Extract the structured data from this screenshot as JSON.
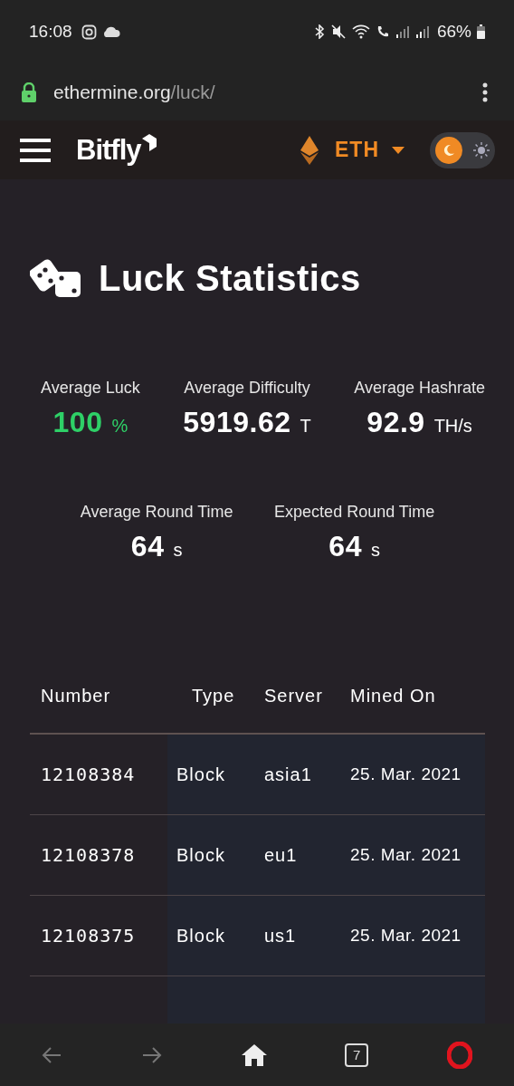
{
  "status_bar": {
    "time": "16:08",
    "battery": "66%"
  },
  "address_bar": {
    "domain": "ethermine.org",
    "path": "/luck/"
  },
  "navbar": {
    "logo": "Bitfly",
    "currency": "ETH",
    "light_mode": false
  },
  "page": {
    "title": "Luck Statistics"
  },
  "stats": [
    {
      "label": "Average Luck",
      "value": "100",
      "unit": "%",
      "good": true
    },
    {
      "label": "Average Difficulty",
      "value": "5919.62",
      "unit": "T",
      "good": false
    },
    {
      "label": "Average Hashrate",
      "value": "92.9",
      "unit": "TH/s",
      "good": false
    },
    {
      "label": "Average Round Time",
      "value": "64",
      "unit": "s",
      "good": false
    },
    {
      "label": "Expected Round Time",
      "value": "64",
      "unit": "s",
      "good": false
    }
  ],
  "table": {
    "columns": [
      "Number",
      "Type",
      "Server",
      "Mined On"
    ],
    "rows": [
      [
        "12108384",
        "Block",
        "asia1",
        "25. Mar. 2021"
      ],
      [
        "12108378",
        "Block",
        "eu1",
        "25. Mar. 2021"
      ],
      [
        "12108375",
        "Block",
        "us1",
        "25. Mar. 2021"
      ]
    ]
  },
  "bottom_bar": {
    "tab_count": "7"
  }
}
